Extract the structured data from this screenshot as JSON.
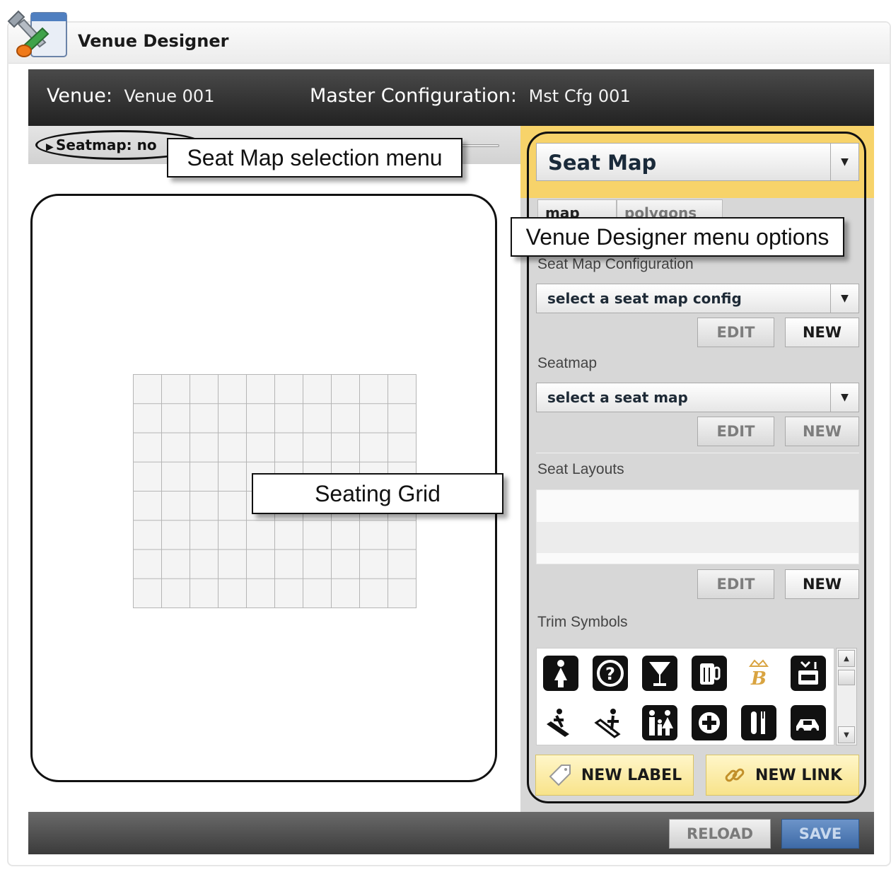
{
  "app": {
    "title": "Venue Designer",
    "logo_icon": "tools-window-icon"
  },
  "header": {
    "venue_label": "Venue:",
    "venue_value": "Venue 001",
    "config_label": "Master Configuration:",
    "config_value": "Mst Cfg 001"
  },
  "seatmap_selector": {
    "text": "Seatmap: no"
  },
  "callouts": {
    "seat_map_selection": "Seat Map selection menu",
    "venue_designer_options": "Venue Designer menu options",
    "seating_grid": "Seating Grid"
  },
  "panel": {
    "mode_dropdown": "Seat Map",
    "tabs": [
      "map",
      "polygons"
    ],
    "seat_map_config": {
      "label": "Seat Map Configuration",
      "select": "select a seat map config",
      "edit": "EDIT",
      "new": "NEW"
    },
    "seatmap": {
      "label": "Seatmap",
      "select": "select a seat map",
      "edit": "EDIT",
      "new": "NEW"
    },
    "seat_layouts": {
      "label": "Seat Layouts",
      "edit": "EDIT",
      "new": "NEW"
    },
    "trim_symbols": {
      "label": "Trim Symbols",
      "icons": [
        "restroom-woman-icon",
        "help-icon",
        "cocktail-icon",
        "beer-mug-icon",
        "crown-logo-icon",
        "atm-icon",
        "escalator-down-icon",
        "escalator-up-icon",
        "family-restroom-icon",
        "first-aid-icon",
        "restaurant-icon",
        "parking-icon"
      ]
    },
    "new_label": "NEW LABEL",
    "new_link": "NEW LINK"
  },
  "footer": {
    "reload": "RELOAD",
    "save": "SAVE"
  },
  "colors": {
    "header_bg": "#2b2b2b",
    "highlight": "#f7d36a",
    "save_blue": "#4a76b0",
    "panel_bg": "#d7d7d7"
  }
}
